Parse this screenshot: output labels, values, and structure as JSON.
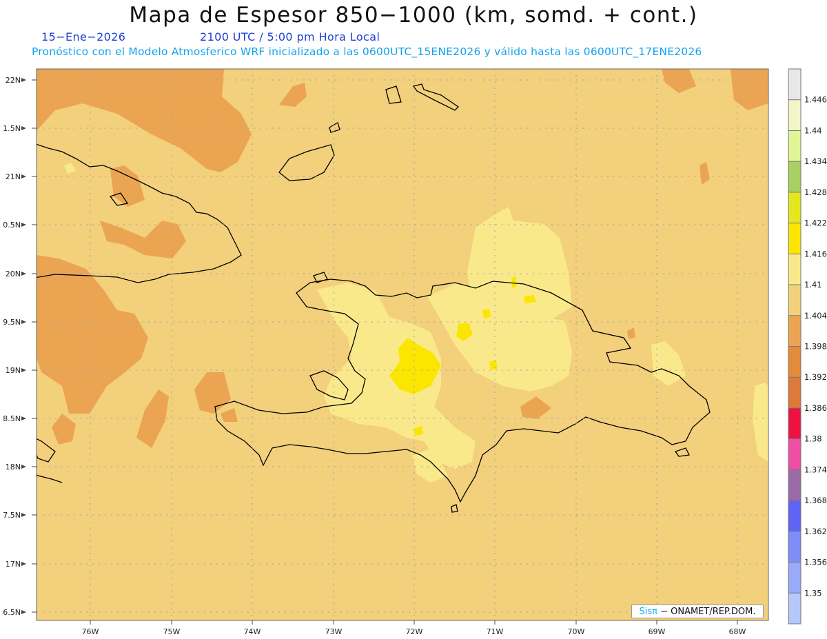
{
  "title": "Mapa de Espesor 850−1000 (km, somd. + cont.)",
  "date_label": "15−Ene−2026",
  "time_label": "2100 UTC / 5:00 pm Hora Local",
  "model_info": "Pronóstico con el Modelo Atmosferico WRF inicializado a las 0600UTC_15ENE2026 y válido hasta las  0600UTC_17ENE2026",
  "credit": {
    "brand": "Sisπ",
    "org": " − ONAMET/REP.DOM."
  },
  "lat_ticks": [
    "22N",
    "1.5N",
    "21N",
    "0.5N",
    "20N",
    "9.5N",
    "19N",
    "8.5N",
    "18N",
    "7.5N",
    "17N",
    "6.5N"
  ],
  "lon_ticks": [
    "76W",
    "75W",
    "74W",
    "73W",
    "72W",
    "71W",
    "70W",
    "69W",
    "68W"
  ],
  "colorbar": {
    "labels": [
      "1.446",
      "1.44",
      "1.434",
      "1.428",
      "1.422",
      "1.416",
      "1.41",
      "1.404",
      "1.398",
      "1.392",
      "1.386",
      "1.38",
      "1.374",
      "1.368",
      "1.362",
      "1.356",
      "1.35"
    ],
    "colors": [
      "#e8e8e8",
      "#f2f6c8",
      "#dff598",
      "#a8cf62",
      "#e4e61e",
      "#fae600",
      "#fae98a",
      "#f2d07c",
      "#eba552",
      "#e48b3a",
      "#dc7a3a",
      "#ee1242",
      "#f04ea6",
      "#9a6ba6",
      "#5f64f4",
      "#7f8ef6",
      "#98aaf8",
      "#b6c7fb"
    ]
  },
  "colors": {
    "base_field": "#f2d07c",
    "lower_field": "#eba552",
    "higher_field": "#fae98a",
    "highest_field": "#fae600",
    "coastline": "#000000"
  }
}
